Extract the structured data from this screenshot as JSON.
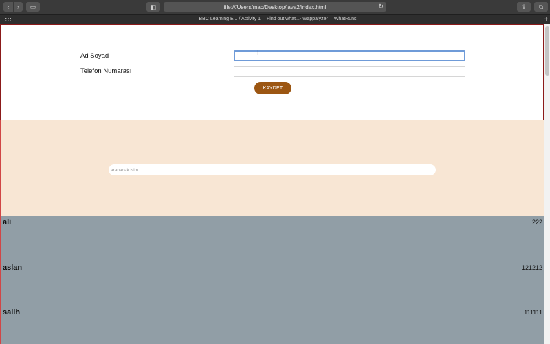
{
  "browser": {
    "url": "file:///Users/mac/Desktop/java2/index.html",
    "favorites": [
      "BBC Learning E... / Activity 1",
      "Find out what...- Wappalyzer",
      "WhatRuns"
    ]
  },
  "form": {
    "name_label": "Ad Soyad",
    "phone_label": "Telefon Numarası",
    "name_value": "",
    "phone_value": "",
    "save_label": "KAYDET"
  },
  "search": {
    "placeholder": "aranacak isim",
    "value": ""
  },
  "contacts": [
    {
      "name": "ali",
      "phone": "222"
    },
    {
      "name": "aslan",
      "phone": "121212"
    },
    {
      "name": "salih",
      "phone": "111111"
    }
  ],
  "colors": {
    "button": "#9c5612",
    "search_bg": "#f8e6d4",
    "list_bg": "#919ea6",
    "focus_ring": "#6f9bd8"
  }
}
